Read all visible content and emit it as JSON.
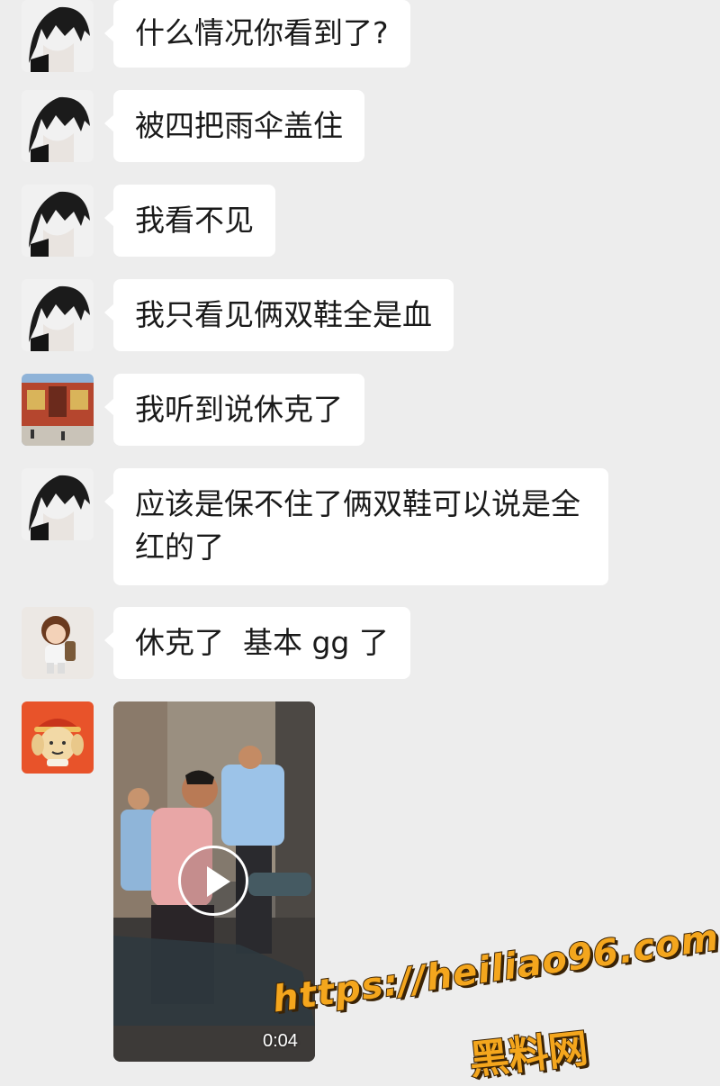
{
  "messages": [
    {
      "sender": "dark-hair-anime-avatar",
      "text": "什么情况你看到了?"
    },
    {
      "sender": "dark-hair-anime-avatar",
      "text": "被四把雨伞盖住"
    },
    {
      "sender": "dark-hair-anime-avatar",
      "text": "我看不见"
    },
    {
      "sender": "dark-hair-anime-avatar",
      "text": "我只看见俩双鞋全是血"
    },
    {
      "sender": "temple-photo-avatar",
      "text": "我听到说休克了"
    },
    {
      "sender": "dark-hair-anime-avatar",
      "text": "应该是保不住了俩双鞋可以说是全\n红的了"
    },
    {
      "sender": "cartoon-kid-avatar",
      "text": "休克了  基本 gg 了"
    }
  ],
  "video_message": {
    "sender": "dog-cartoon-avatar",
    "duration": "0:04"
  },
  "watermark": {
    "url": "https://heiliao96.com",
    "name": "黑料网"
  },
  "colors": {
    "background": "#ededed",
    "bubble": "#ffffff",
    "text": "#1a1a1a",
    "watermark": "#f4a61d"
  }
}
